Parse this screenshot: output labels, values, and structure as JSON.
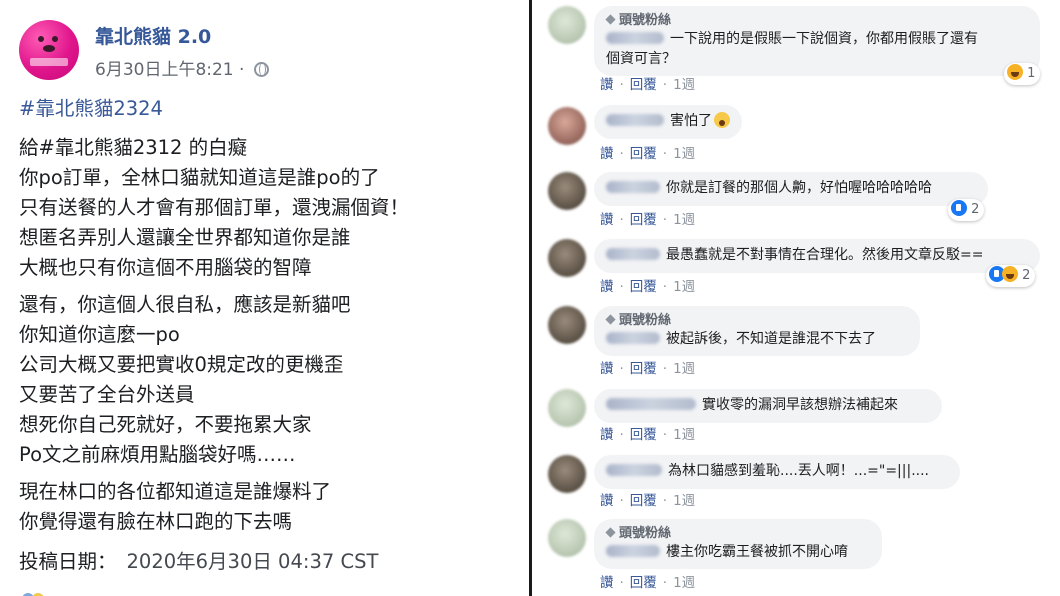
{
  "post": {
    "page_name": "靠北熊貓 2.0",
    "timestamp": "6月30日上午8:21 ·",
    "hashtag": "#靠北熊貓2324",
    "paragraph1": [
      "給#靠北熊貓2312 的白癡",
      "你po訂單，全林口貓就知道這是誰po的了",
      "只有送餐的人才會有那個訂單，還洩漏個資！",
      "想匿名弄別人還讓全世界都知道你是誰",
      "大概也只有你這個不用腦袋的智障"
    ],
    "paragraph2": [
      "還有，你這個人很自私，應該是新貓吧",
      "你知道你這麼一po",
      "公司大概又要把實收0規定改的更機歪",
      "又要苦了全台外送員",
      "想死你自己死就好，不要拖累大家",
      "Po文之前麻煩用點腦袋好嗎……"
    ],
    "paragraph3": [
      "現在林口的各位都知道這是誰爆料了",
      "你覺得還有臉在林口跑的下去嗎"
    ],
    "date_label": "投稿日期：",
    "date_value": "2020年6月30日 04:37 CST"
  },
  "comment_actions": {
    "like": "讚",
    "reply": "回覆",
    "time": "1週"
  },
  "top_fan_badge": "頭號粉絲",
  "comments": [
    {
      "text_line1": "一下說用的是假賬一下說個資，你都用假賬了還有",
      "text_line2": "個資可言？",
      "reaction_count": "1"
    },
    {
      "text": "害怕了"
    },
    {
      "text": "你就是訂餐的那個人齁，好怕喔哈哈哈哈哈",
      "reaction_count": "2"
    },
    {
      "text": "最愚蠢就是不對事情在合理化。然後用文章反駁==",
      "reaction_count": "2"
    },
    {
      "text": "被起訴後，不知道是誰混不下去了"
    },
    {
      "text": "實收零的漏洞早該想辦法補起來"
    },
    {
      "text": "為林口貓感到羞恥....丟人啊！...=\"=|||...."
    },
    {
      "text": "樓主你吃霸王餐被抓不開心唷"
    }
  ]
}
